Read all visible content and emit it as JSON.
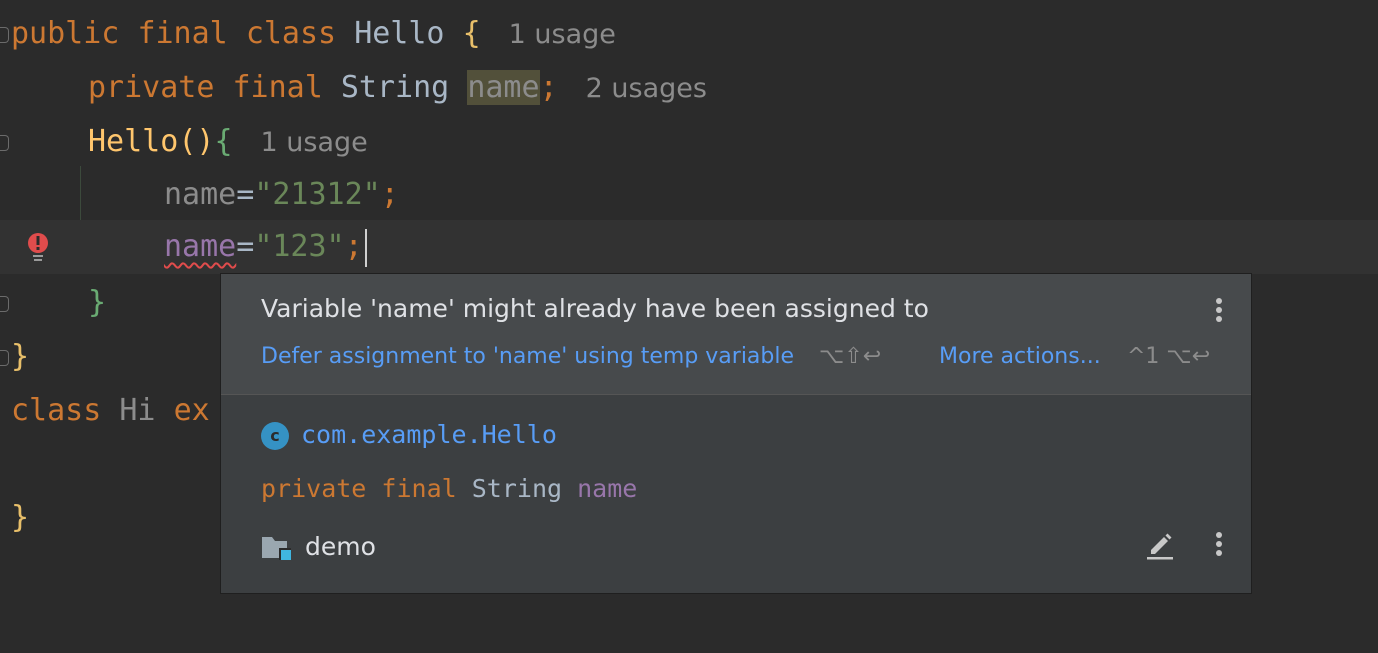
{
  "editor": {
    "lines": {
      "l1": {
        "kw1": "public",
        "kw2": "final",
        "kw3": "class",
        "name": "Hello",
        "brace": "{",
        "hint": "1 usage"
      },
      "l2": {
        "kw1": "private",
        "kw2": "final",
        "type": "String",
        "field": "name",
        "semi": ";",
        "hint": "2 usages"
      },
      "l3": {
        "ctor": "Hello",
        "parens": "()",
        "brace": "{",
        "hint": "1 usage"
      },
      "l4": {
        "field": "name",
        "eq": "=",
        "value": "\"21312\"",
        "semi": ";"
      },
      "l5": {
        "field": "name",
        "eq": "=",
        "value": "\"123\"",
        "semi": ";"
      },
      "l6": {
        "brace": "}"
      },
      "l7": {
        "brace": "}"
      },
      "l8": {
        "kw": "class",
        "name": "Hi",
        "rest": "ex"
      },
      "l10": {
        "brace": "}"
      }
    }
  },
  "popup": {
    "message": "Variable 'name' might already have been assigned to",
    "action": "Defer assignment to 'name' using temp variable",
    "action_shortcut": "⌥⇧↩",
    "more_actions": "More actions...",
    "more_shortcut": "^1 ⌥↩",
    "class_icon_letter": "c",
    "class_fqn": "com.example.Hello",
    "decl": {
      "kw1": "private",
      "kw2": "final",
      "type": "String",
      "field": "name"
    },
    "module": "demo"
  },
  "colors": {
    "background": "#2b2b2b",
    "keyword": "#cc7832",
    "string": "#6a8759",
    "field": "#9876aa",
    "link": "#589df6",
    "error": "#e04c4c"
  }
}
